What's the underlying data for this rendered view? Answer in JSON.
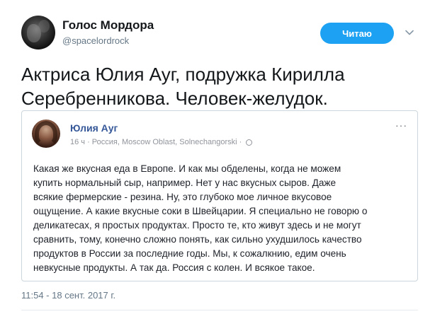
{
  "author": {
    "name": "Голос Мордора",
    "handle": "@spacelordrock"
  },
  "header": {
    "follow_label": "Читаю",
    "caret_icon": "chevron-down-icon"
  },
  "tweet": {
    "text": "Актриса Юлия Ауг, подружка Кирилла Серебренникова. Человек-желудок.",
    "timestamp": "11:54 - 18 сент. 2017 г."
  },
  "embedded_post": {
    "author_name": "Юлия Ауг",
    "meta": "16 ч · Россия, Moscow Oblast, Solnechangorski ·",
    "privacy_icon": "globe-icon",
    "more_label": "···",
    "body_lines": [
      "Какая же вкусная еда в Европе. И как мы обделены, когда не можем",
      "купить нормальный сыр, например. Нет у нас вкусных сыров. Даже",
      "всякие фермерские - резина. Ну, это глубоко мое личное вкусовое",
      "ощущение. А какие вкусные соки в Швейцарии. Я специально не говорю о",
      "деликатесах, я простых продуктах. Просто те, кто живут здесь и не могут",
      "сравнить, тому, конечно сложно понять, как сильно ухудшилось качество",
      "продуктов в России за последние годы. Мы, к сожалкнию, едим очень",
      "невкусные продукты. А так да. Россия с колен. И всякое такое."
    ]
  },
  "colors": {
    "follow_button": "#1da1f2",
    "fb_name": "#365899",
    "secondary_text": "#657786"
  }
}
